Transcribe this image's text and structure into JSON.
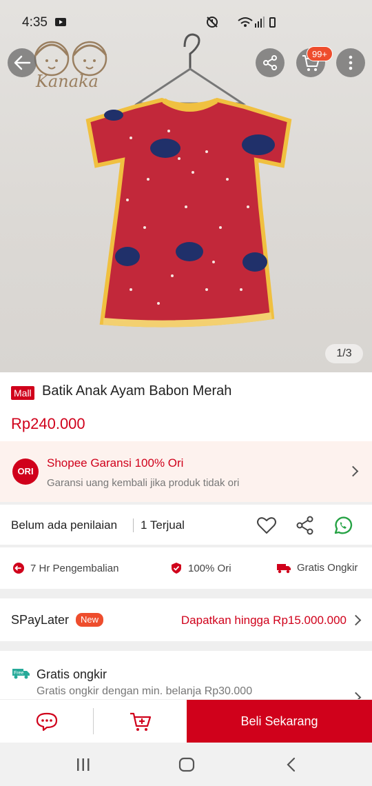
{
  "status_bar": {
    "time": "4:35"
  },
  "hero": {
    "brand_text": "Kanaka",
    "cart_badge": "99+",
    "image_counter": "1/3"
  },
  "product": {
    "mall_badge": "Mall",
    "title": "Batik Anak Ayam Babon Merah",
    "price": "Rp240.000"
  },
  "guarantee": {
    "badge": "ORI",
    "title": "Shopee Garansi 100% Ori",
    "subtitle": "Garansi uang kembali jika produk tidak ori"
  },
  "rating": {
    "rating_text": "Belum ada penilaian",
    "sold_text": "1 Terjual"
  },
  "features": [
    {
      "label": "7 Hr Pengembalian",
      "icon": "return-icon"
    },
    {
      "label": "100% Ori",
      "icon": "shield-icon"
    },
    {
      "label": "Gratis Ongkir",
      "icon": "truck-icon"
    }
  ],
  "spaylater": {
    "label": "SPayLater",
    "badge": "New",
    "offer": "Dapatkan hingga Rp15.000.000"
  },
  "shipping": {
    "icon_text": "Free",
    "title": "Gratis ongkir",
    "subtitle": "Gratis ongkir dengan min. belanja Rp30.000"
  },
  "action_bar": {
    "buy_label": "Beli Sekarang"
  },
  "colors": {
    "brand_red": "#d0011b",
    "shopee_orange": "#ee4d2d",
    "whatsapp_green": "#25a244",
    "dress_red": "#c2283a"
  }
}
